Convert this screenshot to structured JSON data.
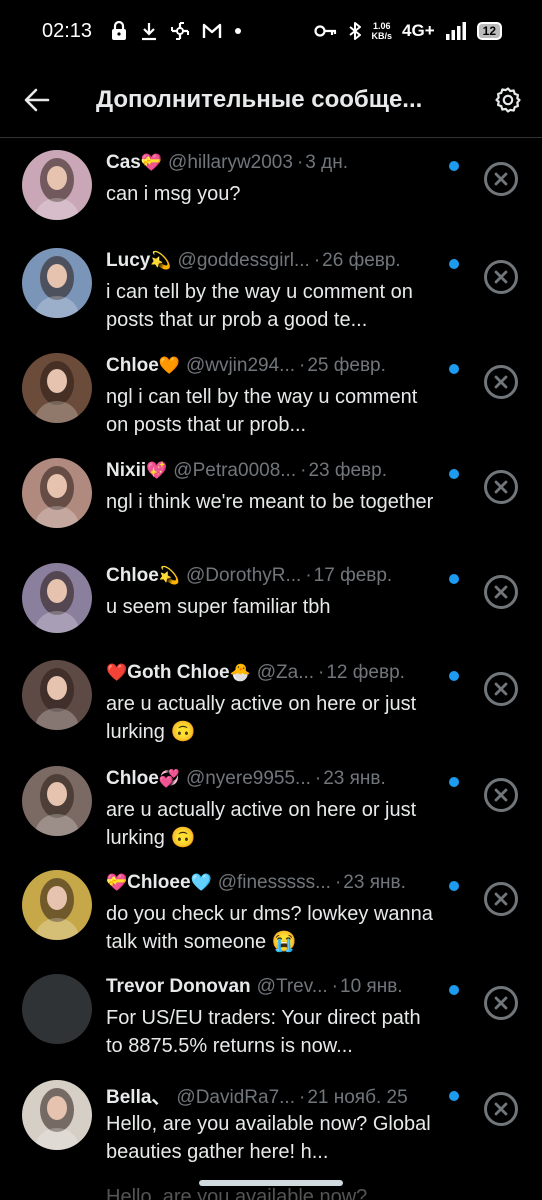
{
  "status_bar": {
    "time": "02:13",
    "net_speed_value": "1.06",
    "net_speed_unit": "KB/s",
    "network_type": "4G+",
    "battery": "12"
  },
  "header": {
    "title": "Дополнительные сообще..."
  },
  "messages": [
    {
      "name": "Cas",
      "name_emoji": "💝",
      "handle": "@hillaryw2003",
      "date": "3 дн.",
      "text": "can i msg you?",
      "avatar_color": "#c9a7b7"
    },
    {
      "name": "Lucy",
      "name_emoji": "💫",
      "handle": "@goddessgirl...",
      "date": "26 февр.",
      "text": "i can tell by the way u comment on posts that ur prob a good te...",
      "avatar_color": "#7a95b8"
    },
    {
      "name": "Chloe",
      "name_emoji": "🧡",
      "handle": "@wvjin294...",
      "date": "25 февр.",
      "text": "ngl i can tell by the way u comment on posts that ur prob...",
      "avatar_color": "#6b4c3a"
    },
    {
      "name": "Nixii",
      "name_emoji": "💖",
      "handle": "@Petra0008...",
      "date": "23 февр.",
      "text": "ngl i think we're meant to be together",
      "avatar_color": "#b08a7e"
    },
    {
      "name": "Chloe",
      "name_emoji": "💫",
      "handle": "@DorothyR...",
      "date": "17 февр.",
      "text": "u seem super familiar tbh",
      "avatar_color": "#8b7f9e"
    },
    {
      "name": "Goth Chloe",
      "name_prefix_emoji": "❤️",
      "name_emoji": "🐣",
      "handle": "@Za...",
      "date": "12 февр.",
      "text": "are u actually active on here or just lurking 🙃",
      "avatar_color": "#5e4a45"
    },
    {
      "name": "Chloe",
      "name_emoji": "💞",
      "handle": "@nyere9955...",
      "date": "23 янв.",
      "text": "are u actually active on here or just lurking 🙃",
      "avatar_color": "#7b6a63"
    },
    {
      "name": "Chloee",
      "name_prefix_emoji": "💝",
      "name_emoji": "🩵",
      "handle": "@finesssss...",
      "date": "23 янв.",
      "text": "do you check ur dms? lowkey wanna talk with someone 😭",
      "avatar_color": "#c7a848"
    },
    {
      "name": "Trevor Donovan",
      "name_emoji": "",
      "handle": "@Trev...",
      "date": "10 янв.",
      "text": "For US/EU traders: Your direct path to 8875.5% returns is now...",
      "avatar_color": "#2f3336"
    },
    {
      "name": "Bella、",
      "name_emoji": "",
      "handle": "@DavidRa7...",
      "date": "21 нояб. 25",
      "text": "Hello, are you available now? Global beauties gather here! h...",
      "avatar_color": "#d5cfc6"
    }
  ],
  "peek_text": "Hello, are you available now?",
  "colors": {
    "background": "#000000",
    "accent": "#1d9bf0",
    "muted": "#71767b",
    "text": "#e7e9ea"
  },
  "icons": {
    "back": "arrow-left-icon",
    "settings": "gear-icon",
    "dismiss": "close-circle-icon"
  }
}
